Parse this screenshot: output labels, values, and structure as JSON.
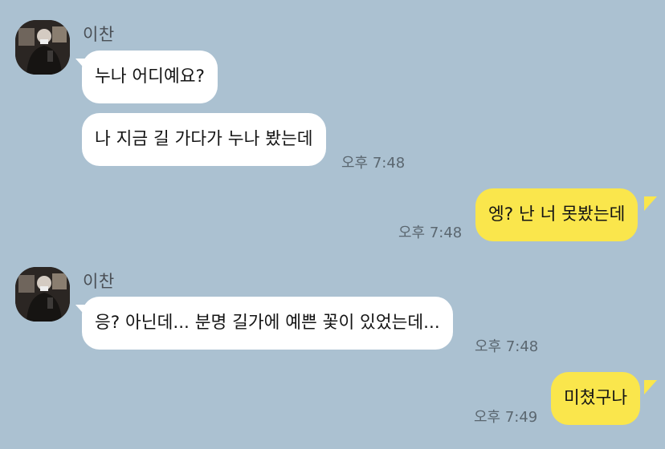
{
  "chat": {
    "groups": [
      {
        "sender": "이찬",
        "messages": [
          "누나 어디예요?",
          "나 지금 길 가다가 누나 봤는데"
        ],
        "time": "오후 7:48"
      },
      {
        "sender": "이찬",
        "messages": [
          "응? 아닌데... 분명 길가에 예쁜 꽃이 있었는데..."
        ],
        "time": "오후 7:48"
      }
    ],
    "outgoing": [
      {
        "text": "엥? 난 너 못봤는데",
        "time": "오후 7:48"
      },
      {
        "text": "미쳤구나",
        "time": "오후 7:49"
      }
    ]
  },
  "colors": {
    "background": "#abc1d1",
    "incoming_bubble": "#ffffff",
    "outgoing_bubble": "#fae64c",
    "timestamp": "#5b6770",
    "sender_name": "#4a4f55"
  },
  "icons": {
    "avatar": "profile-photo"
  }
}
